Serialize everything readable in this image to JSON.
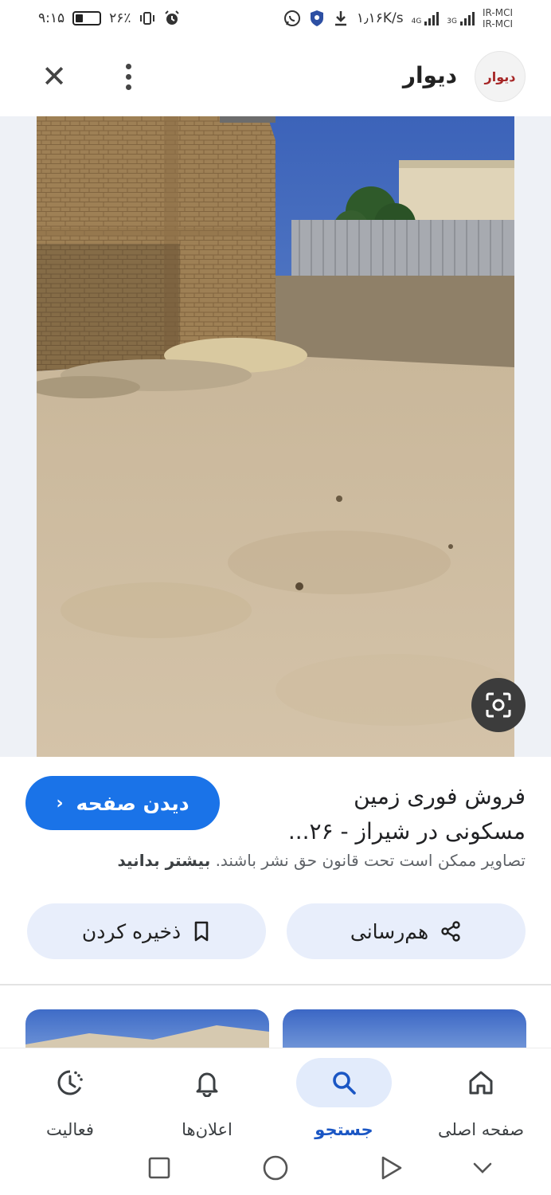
{
  "status_bar": {
    "time": "۹:۱۵",
    "battery": "۲۶٪",
    "speed": "۱٫۱۶K/s",
    "network_4g": "4G",
    "network_3g": "3G",
    "carrier_1": "IR-MCI",
    "carrier_2": "IR-MCI"
  },
  "app_bar": {
    "site_name": "دیوار",
    "site_logo_text": "دیوار",
    "close_icon": "close-icon",
    "menu_icon": "more-vert-icon"
  },
  "image": {
    "description_icon": "lens-search-icon"
  },
  "info": {
    "visit_button_label": "دیدن صفحه",
    "title_line_1": "فروش فوری زمین",
    "title_line_2": "مسکونی در شیراز - ۲۶...",
    "copyright_text": "تصاویر ممکن است تحت قانون حق نشر باشند.",
    "learn_more": "بیشتر بدانید",
    "share_label": "هم‌رسانی",
    "save_label": "ذخیره کردن"
  },
  "bottom_nav": {
    "items": [
      {
        "label": "صفحه اصلی",
        "icon": "home-icon"
      },
      {
        "label": "جستجو",
        "icon": "search-icon",
        "active": true
      },
      {
        "label": "اعلان‌ها",
        "icon": "bell-icon"
      },
      {
        "label": "فعالیت",
        "icon": "activity-icon"
      }
    ]
  },
  "colors": {
    "accent": "#1a73e8",
    "pill_bg": "#e8eefb",
    "active_nav_bg": "#e2ebfb",
    "logo_red": "#a62626"
  }
}
